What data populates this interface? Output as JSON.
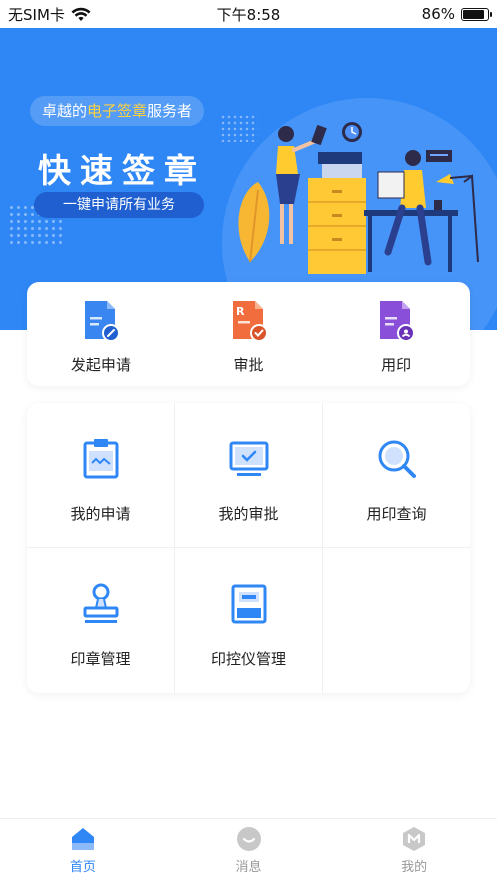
{
  "status_bar": {
    "carrier": "无SIM卡",
    "time": "下午8:58",
    "battery_percent": "86%",
    "battery_level": 0.86
  },
  "banner": {
    "slogan_prefix": "卓越的",
    "slogan_highlight": "电子签章",
    "slogan_suffix": "服务者",
    "title": "快速签章",
    "subtitle": "一键申请所有业务"
  },
  "quick_actions": [
    {
      "label": "发起申请",
      "icon": "apply-doc-icon",
      "color": "#3a86f0"
    },
    {
      "label": "审批",
      "icon": "approve-doc-icon",
      "color": "#f06a3a"
    },
    {
      "label": "用印",
      "icon": "seal-doc-icon",
      "color": "#8a4fd8"
    }
  ],
  "grid_items": [
    {
      "label": "我的申请",
      "icon": "clipboard-icon"
    },
    {
      "label": "我的审批",
      "icon": "monitor-check-icon"
    },
    {
      "label": "用印查询",
      "icon": "search-icon"
    },
    {
      "label": "印章管理",
      "icon": "stamp-icon"
    },
    {
      "label": "印控仪管理",
      "icon": "seal-device-icon"
    }
  ],
  "tab_bar": [
    {
      "label": "首页",
      "icon": "home-icon",
      "active": true
    },
    {
      "label": "消息",
      "icon": "message-icon",
      "active": false
    },
    {
      "label": "我的",
      "icon": "profile-icon",
      "active": false
    }
  ],
  "colors": {
    "brand_blue": "#2f87f5",
    "highlight_yellow": "#ffd23e",
    "icon_blue": "#2f87f5",
    "tab_inactive": "#c8c8c8"
  }
}
